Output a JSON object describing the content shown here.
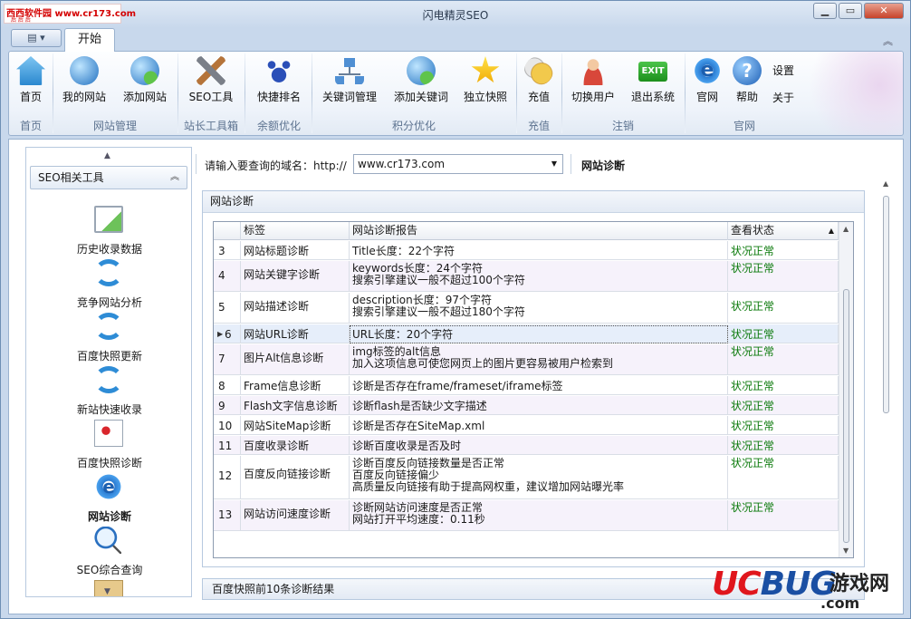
{
  "window": {
    "title": "闪电精灵SEO",
    "logo_text": "西西软件园 www.cr173.com",
    "logo_sub": "后 后 后"
  },
  "ribbon": {
    "tab": "开始",
    "buttons": [
      {
        "label": "首页",
        "icon": "home-icon"
      },
      {
        "label": "我的网站",
        "icon": "globe-icon"
      },
      {
        "label": "添加网站",
        "icon": "globe-add-icon"
      },
      {
        "label": "SEO工具",
        "icon": "tools-icon"
      },
      {
        "label": "快捷排名",
        "icon": "baidu-paw-icon"
      },
      {
        "label": "关键词管理",
        "icon": "network-icon"
      },
      {
        "label": "添加关键词",
        "icon": "globe-add-icon"
      },
      {
        "label": "独立快照",
        "icon": "star-icon"
      },
      {
        "label": "充值",
        "icon": "coins-icon"
      },
      {
        "label": "切换用户",
        "icon": "user-icon"
      },
      {
        "label": "退出系统",
        "icon": "exit-icon"
      },
      {
        "label": "官网",
        "icon": "ie-icon"
      },
      {
        "label": "帮助",
        "icon": "help-icon"
      }
    ],
    "small_buttons": {
      "settings": "设置",
      "about": "关于"
    },
    "groups": [
      "首页",
      "网站管理",
      "站长工具箱",
      "余额优化",
      "积分优化",
      "充值",
      "注销",
      "官网"
    ]
  },
  "sidebar": {
    "header": "SEO相关工具",
    "items": [
      {
        "label": "历史收录数据",
        "icon": "chart-check-icon"
      },
      {
        "label": "竞争网站分析",
        "icon": "refresh-icon"
      },
      {
        "label": "百度快照更新",
        "icon": "refresh-icon"
      },
      {
        "label": "新站快速收录",
        "icon": "refresh-icon"
      },
      {
        "label": "百度快照诊断",
        "icon": "doc-plus-icon"
      },
      {
        "label": "网站诊断",
        "icon": "ie-icon",
        "active": true
      },
      {
        "label": "SEO综合查询",
        "icon": "magnifier-icon"
      }
    ]
  },
  "query": {
    "label": "请输入要查询的域名：http://",
    "domain_value": "www.cr173.com",
    "section_title": "网站诊断"
  },
  "panel": {
    "title": "网站诊断",
    "columns": [
      "标签",
      "网站诊断报告",
      "查看状态"
    ],
    "rows": [
      {
        "no": "3",
        "tag": "网站标题诊断",
        "report": [
          "Title长度：22个字符"
        ],
        "status": "状况正常"
      },
      {
        "no": "4",
        "tag": "网站关键字诊断",
        "report": [
          "keywords长度：24个字符",
          "搜索引擎建议一般不超过100个字符"
        ],
        "status": "状况正常"
      },
      {
        "no": "5",
        "tag": "网站描述诊断",
        "report": [
          "description长度：97个字符",
          "搜索引擎建议一般不超过180个字符"
        ],
        "status": "状况正常"
      },
      {
        "no": "6",
        "tag": "网站URL诊断",
        "report": [
          "URL长度：20个字符"
        ],
        "status": "状况正常",
        "selected": true
      },
      {
        "no": "7",
        "tag": "图片Alt信息诊断",
        "report": [
          "img标签的alt信息",
          "加入这项信息可使您网页上的图片更容易被用户检索到"
        ],
        "status": "状况正常"
      },
      {
        "no": "8",
        "tag": "Frame信息诊断",
        "report": [
          "诊断是否存在frame/frameset/iframe标签"
        ],
        "status": "状况正常"
      },
      {
        "no": "9",
        "tag": "Flash文字信息诊断",
        "report": [
          "诊断flash是否缺少文字描述"
        ],
        "status": "状况正常"
      },
      {
        "no": "10",
        "tag": "网站SiteMap诊断",
        "report": [
          "诊断是否存在SiteMap.xml"
        ],
        "status": "状况正常"
      },
      {
        "no": "11",
        "tag": "百度收录诊断",
        "report": [
          "诊断百度收录是否及时"
        ],
        "status": "状况正常"
      },
      {
        "no": "12",
        "tag": "百度反向链接诊断",
        "report": [
          "诊断百度反向链接数量是否正常",
          "百度反向链接偏少",
          "高质量反向链接有助于提高网权重，建议增加网站曝光率"
        ],
        "status": "状况正常"
      },
      {
        "no": "13",
        "tag": "网站访问速度诊断",
        "report": [
          "诊断网站访问速度是否正常",
          "网站打开平均速度：0.11秒"
        ],
        "status": "状况正常"
      }
    ],
    "footer_title": "百度快照前10条诊断结果"
  },
  "watermark": {
    "brand_a": "UC",
    "brand_b": "BUG",
    "cn": "游戏网",
    "domain": ".com"
  },
  "colors": {
    "status_ok": "#0b7a0b",
    "accent": "#3b6eb4"
  }
}
